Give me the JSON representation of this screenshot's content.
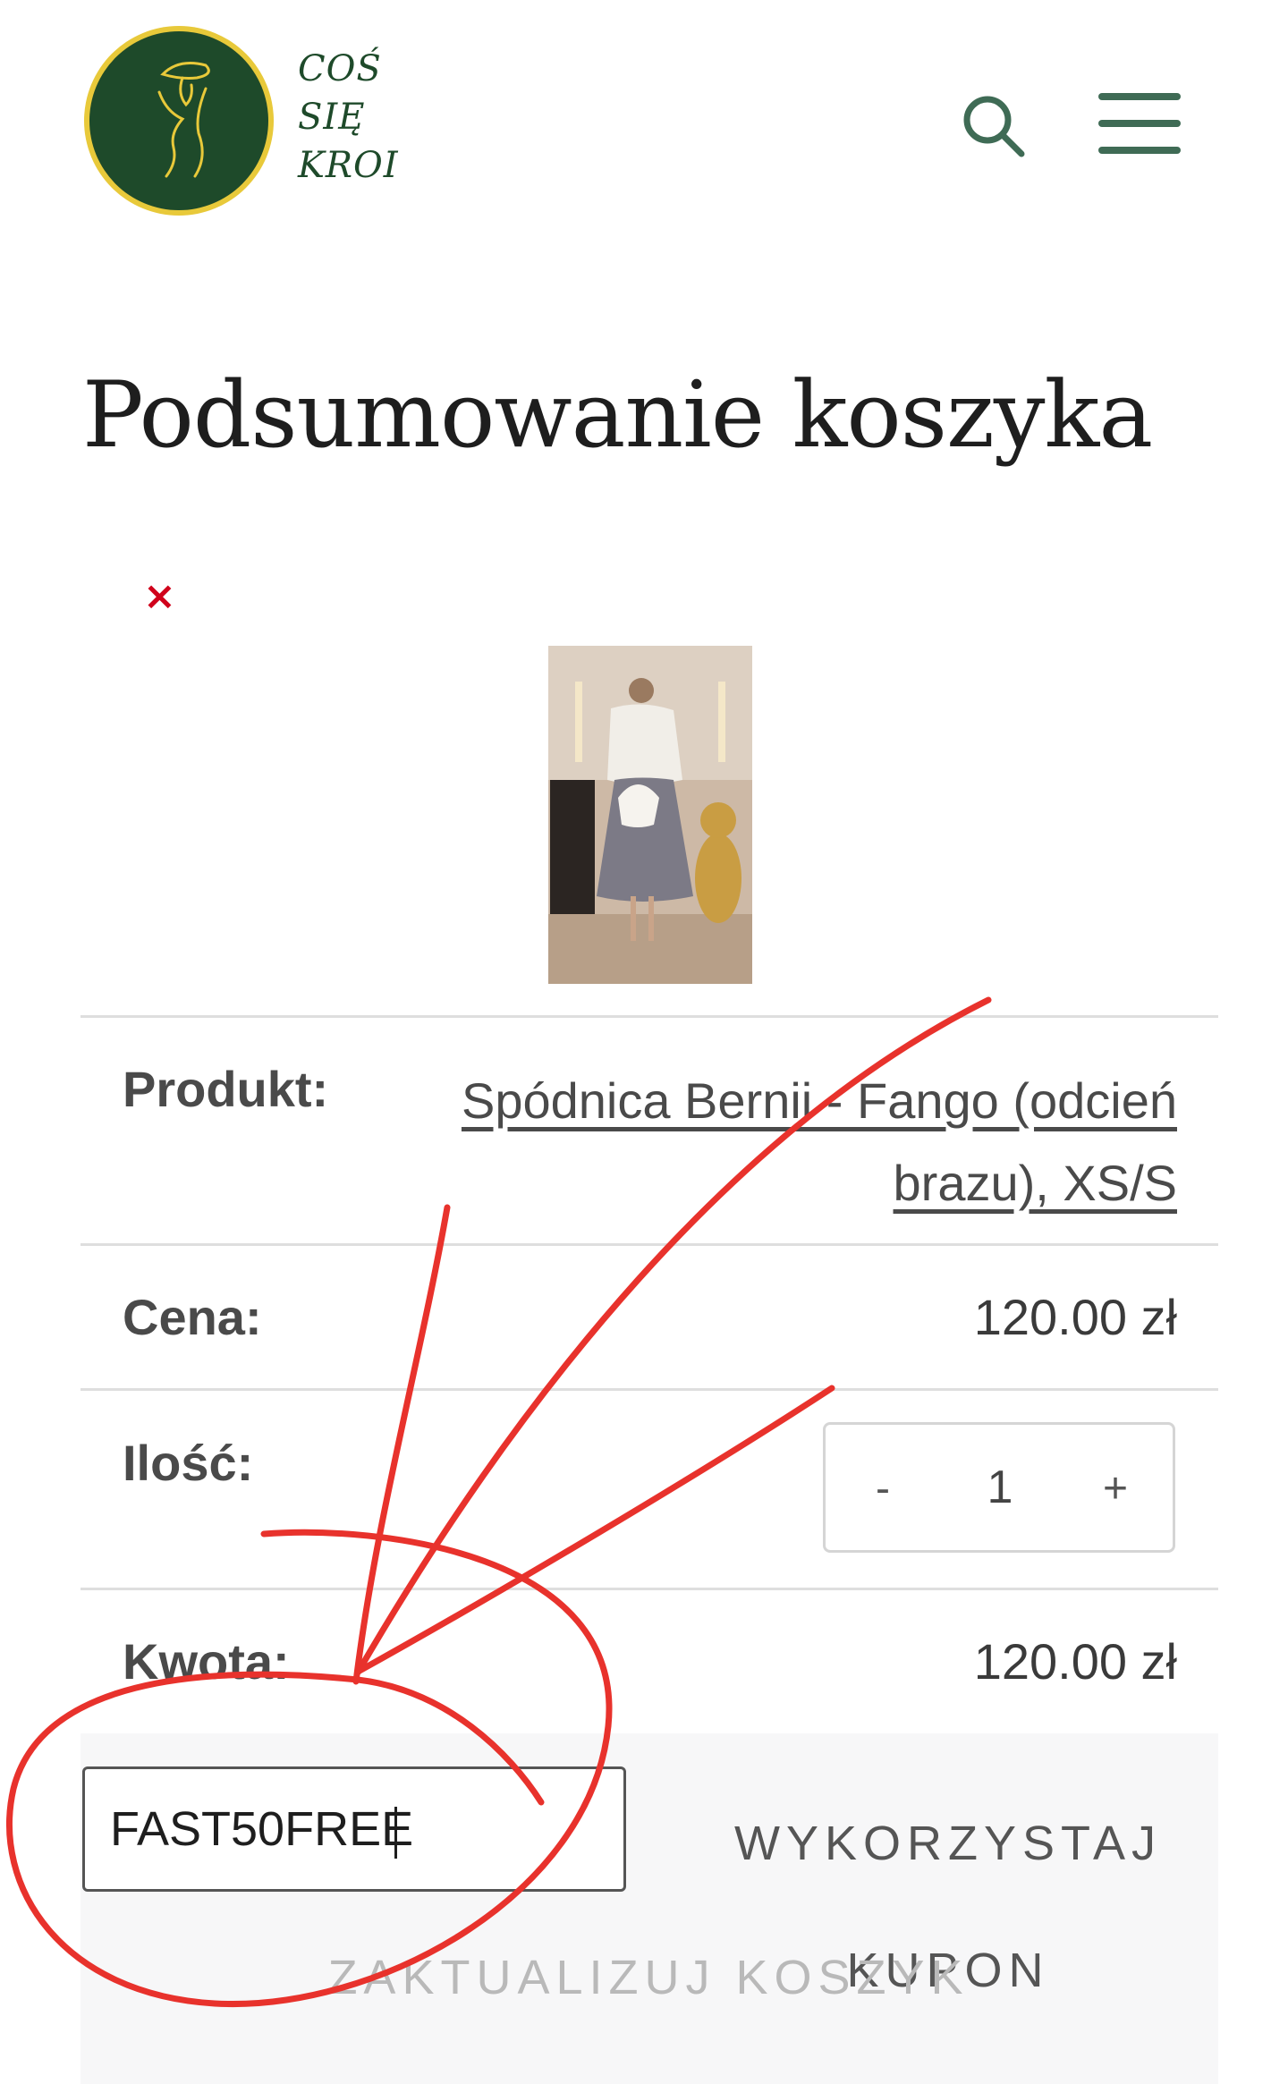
{
  "brand": {
    "logo_lines": [
      "COŚ",
      "SIĘ",
      "KROI"
    ],
    "colors": {
      "logo_bg": "#1e4a2a",
      "logo_ring": "#e8c93a",
      "icon_green": "#3f6b55"
    }
  },
  "header": {
    "search_icon": "search-icon",
    "menu_icon": "hamburger-menu-icon"
  },
  "page": {
    "title": "Podsumowanie koszyka"
  },
  "cart": {
    "remove_symbol": "×",
    "product_label": "Produkt:",
    "product_name": "Spódnica Bernii - Fango (odcień brazu), XS/S",
    "price_label": "Cena:",
    "price": "120.00 zł",
    "quantity_label": "Ilość:",
    "quantity": "1",
    "qty_minus": "-",
    "qty_plus": "+",
    "subtotal_label": "Kwota:",
    "subtotal": "120.00 zł"
  },
  "coupon": {
    "code": "FAST50FREE",
    "apply_line1": "WYKORZYSTAJ",
    "apply_line2": "KUPON"
  },
  "update_cart_label": "ZAKTUALIZUJ KOSZYK",
  "annotation_color": "#e8322c"
}
